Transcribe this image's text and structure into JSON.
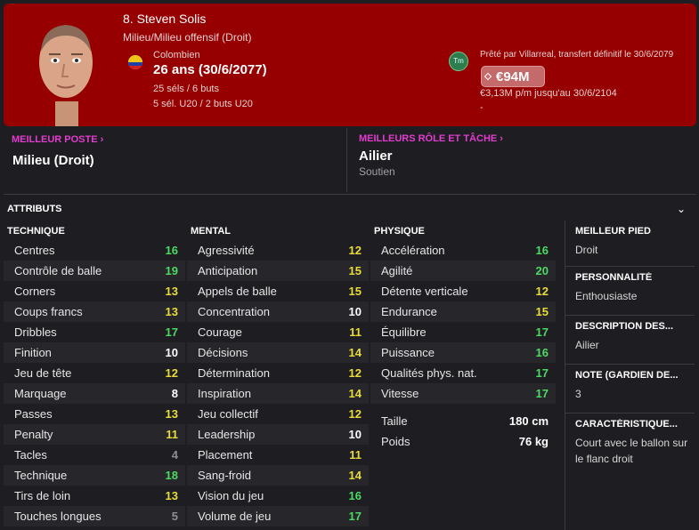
{
  "player": {
    "name": "8. Steven Solis",
    "position": "Milieu/Milieu offensif (Droit)",
    "nationality": "Colombien",
    "age": "26 ans (30/6/2077)",
    "caps": "25 séls / 6 buts",
    "caps_u20": "5 sél. U20 / 2 buts U20"
  },
  "contract": {
    "club_icon": "Tm",
    "loan_text": "Prêté par Villarreal, transfert définitif le 30/6/2079",
    "value": "€94M",
    "wage": "€3,13M p/m jusqu'au 30/6/2104",
    "extra": "-"
  },
  "best_position": {
    "label": "MEILLEUR POSTE",
    "value": "Milieu (Droit)"
  },
  "best_role": {
    "label": "MEILLEURS RÔLE ET TÂCHE",
    "value": "Ailier",
    "duty": "Soutien"
  },
  "attributes": {
    "header": "ATTRIBUTS",
    "technique": {
      "title": "TECHNIQUE",
      "items": [
        {
          "name": "Centres",
          "value": "16"
        },
        {
          "name": "Contrôle de balle",
          "value": "19"
        },
        {
          "name": "Corners",
          "value": "13"
        },
        {
          "name": "Coups francs",
          "value": "13"
        },
        {
          "name": "Dribbles",
          "value": "17"
        },
        {
          "name": "Finition",
          "value": "10"
        },
        {
          "name": "Jeu de tête",
          "value": "12"
        },
        {
          "name": "Marquage",
          "value": "8"
        },
        {
          "name": "Passes",
          "value": "13"
        },
        {
          "name": "Penalty",
          "value": "11"
        },
        {
          "name": "Tacles",
          "value": "4"
        },
        {
          "name": "Technique",
          "value": "18"
        },
        {
          "name": "Tirs de loin",
          "value": "13"
        },
        {
          "name": "Touches longues",
          "value": "5"
        }
      ]
    },
    "mental": {
      "title": "MENTAL",
      "items": [
        {
          "name": "Agressivité",
          "value": "12"
        },
        {
          "name": "Anticipation",
          "value": "15"
        },
        {
          "name": "Appels de balle",
          "value": "15"
        },
        {
          "name": "Concentration",
          "value": "10"
        },
        {
          "name": "Courage",
          "value": "11"
        },
        {
          "name": "Décisions",
          "value": "14"
        },
        {
          "name": "Détermination",
          "value": "12"
        },
        {
          "name": "Inspiration",
          "value": "14"
        },
        {
          "name": "Jeu collectif",
          "value": "12"
        },
        {
          "name": "Leadership",
          "value": "10"
        },
        {
          "name": "Placement",
          "value": "11"
        },
        {
          "name": "Sang-froid",
          "value": "14"
        },
        {
          "name": "Vision du jeu",
          "value": "16"
        },
        {
          "name": "Volume de jeu",
          "value": "17"
        }
      ]
    },
    "physique": {
      "title": "PHYSIQUE",
      "items": [
        {
          "name": "Accélération",
          "value": "16"
        },
        {
          "name": "Agilité",
          "value": "20"
        },
        {
          "name": "Détente verticale",
          "value": "12"
        },
        {
          "name": "Endurance",
          "value": "15"
        },
        {
          "name": "Équilibre",
          "value": "17"
        },
        {
          "name": "Puissance",
          "value": "16"
        },
        {
          "name": "Qualités phys. nat.",
          "value": "17"
        },
        {
          "name": "Vitesse",
          "value": "17"
        }
      ],
      "height_label": "Taille",
      "height": "180 cm",
      "weight_label": "Poids",
      "weight": "76 kg"
    }
  },
  "info": {
    "foot_label": "MEILLEUR PIED",
    "foot": "Droit",
    "personality_label": "PERSONNALITÉ",
    "personality": "Enthousiaste",
    "desc_label": "DESCRIPTION DES...",
    "desc": "Ailier",
    "gk_label": "NOTE (GARDIEN DE...",
    "gk": "3",
    "trait_label": "CARACTÉRISTIQUE...",
    "trait": "Court avec le ballon sur le flanc droit"
  },
  "colors": {
    "header_bg": "#960000",
    "accent_pink": "#e23ccf",
    "high": "#4cd964",
    "mid": "#e8dc3a",
    "low": "#8d8d93"
  }
}
